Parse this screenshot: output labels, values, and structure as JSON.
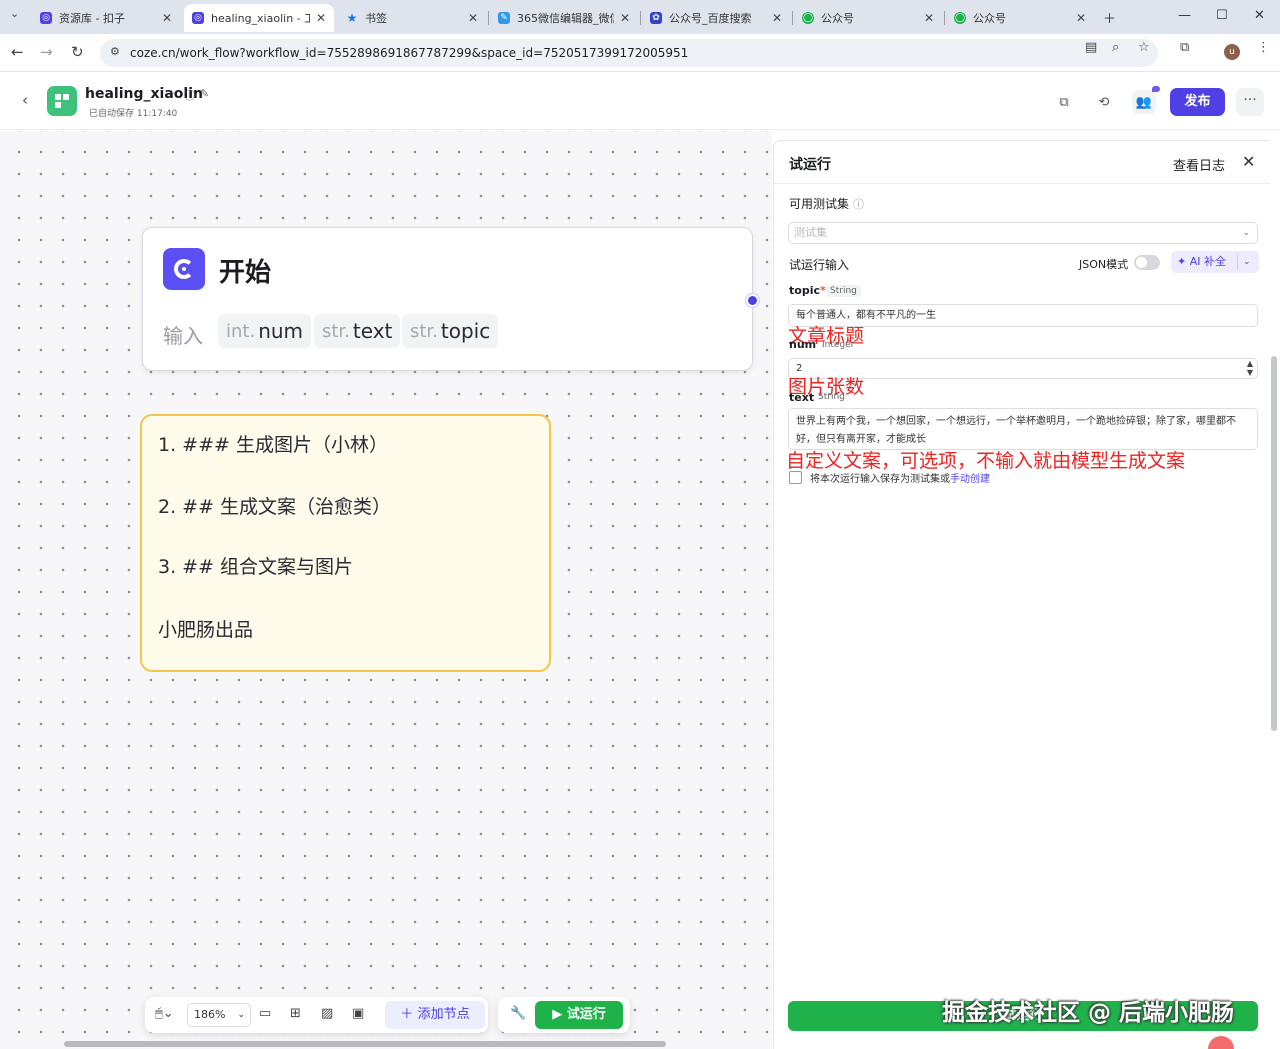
{
  "browser": {
    "tabs": [
      {
        "title": "资源库 - 扣子",
        "color": "#4e40e5"
      },
      {
        "title": "healing_xiaolin - 工",
        "color": "#4e40e5"
      },
      {
        "title": "书签",
        "color": "#1a73e8"
      },
      {
        "title": "365微信编辑器_微信",
        "color": "#2f9be8"
      },
      {
        "title": "公众号_百度搜索",
        "color": "#2f43c8"
      },
      {
        "title": "公众号",
        "color": "#1fb24a"
      },
      {
        "title": "公众号",
        "color": "#1fb24a"
      }
    ],
    "url": "coze.cn/work_flow?workflow_id=7552898691867787299&space_id=7520517399172005951",
    "profile_initial": "u"
  },
  "header": {
    "app_name": "healing_xiaolin",
    "saved_status": "已自动保存 11:17:40",
    "publish_label": "发布",
    "more_label": "···"
  },
  "canvas": {
    "start_node": {
      "title": "开始",
      "input_label": "输入",
      "params": [
        {
          "type": "int.",
          "name": "num"
        },
        {
          "type": "str.",
          "name": "text"
        },
        {
          "type": "str.",
          "name": "topic"
        }
      ]
    },
    "note_lines": [
      "1. ### 生成图片（小林）",
      "2. ## 生成文案（治愈类）",
      "3. ## 组合文案与图片",
      "小肥肠出品"
    ],
    "toolbar": {
      "zoom": "186%",
      "add_node_label": "添加节点",
      "run_label": "试运行"
    }
  },
  "panel": {
    "title": "试运行",
    "view_log": "查看日志",
    "testset_label": "可用测试集",
    "testset_placeholder": "测试集",
    "run_input_label": "试运行输入",
    "json_mode_label": "JSON模式",
    "ai_fill_label": "AI 补全",
    "fields": {
      "topic": {
        "name": "topic",
        "type": "String",
        "value": "每个普通人，都有不平凡的一生"
      },
      "num": {
        "name": "num",
        "type": "Integer",
        "value": "2"
      },
      "text": {
        "name": "text",
        "type": "String",
        "value": "世界上有两个我，一个想回家，一个想远行，一个举杯邀明月，一个跪地捡碎银；除了家，哪里都不好，但只有离开家，才能成长"
      }
    },
    "annotations": {
      "topic": "文章标题",
      "num": "图片张数",
      "text": "自定义文案，可选项，不输入就由模型生成文案"
    },
    "save_checkbox_label": "将本次运行输入保存为测试集或",
    "save_checkbox_link": "手动创建",
    "run_button_label": "试运行",
    "watermark": "掘金技术社区 @ 后端小肥肠"
  }
}
